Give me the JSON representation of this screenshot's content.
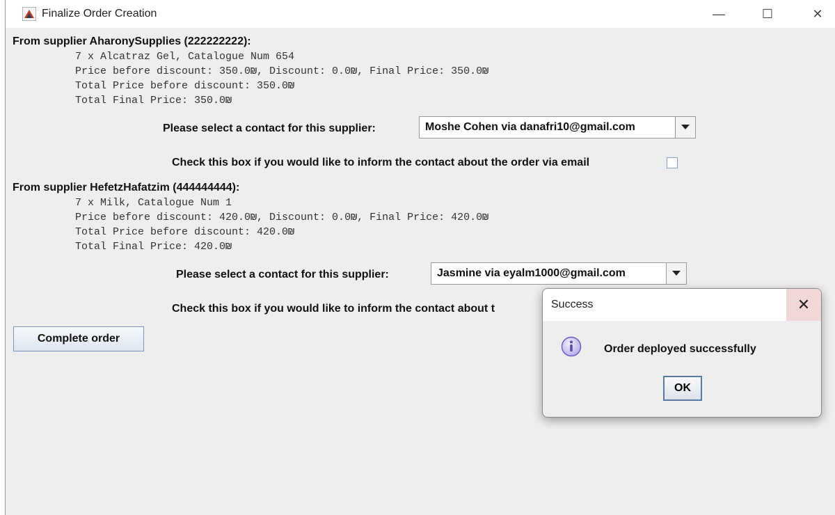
{
  "window": {
    "title": "Finalize Order Creation",
    "controls": {
      "minimize": "—",
      "maximize": "☐",
      "close": "✕"
    }
  },
  "suppliers": [
    {
      "header": "From supplier AharonySupplies (222222222):",
      "lines": [
        "7 x Alcatraz Gel, Catalogue Num 654",
        "Price before discount: 350.0₪, Discount: 0.0₪, Final Price: 350.0₪",
        "Total Price before discount: 350.0₪",
        "Total Final Price: 350.0₪"
      ],
      "contact_label": "Please select a contact for this supplier:",
      "contact_value": "Moshe Cohen via danafri10@gmail.com",
      "email_label": "Check this box if you would like to inform the contact about the order via email",
      "email_checked": false
    },
    {
      "header": "From supplier HefetzHafatzim (444444444):",
      "lines": [
        "7 x Milk, Catalogue Num 1",
        "Price before discount: 420.0₪, Discount: 0.0₪, Final Price: 420.0₪",
        "Total Price before discount: 420.0₪",
        "Total Final Price: 420.0₪"
      ],
      "contact_label": "Please select a contact for this supplier:",
      "contact_value": "Jasmine via eyalm1000@gmail.com",
      "email_label": "Check this box if you would like to inform the contact about t",
      "email_checked": false
    }
  ],
  "complete_button": "Complete order",
  "dialog": {
    "title": "Success",
    "close": "✕",
    "message": "Order deployed successfully",
    "ok": "OK"
  }
}
